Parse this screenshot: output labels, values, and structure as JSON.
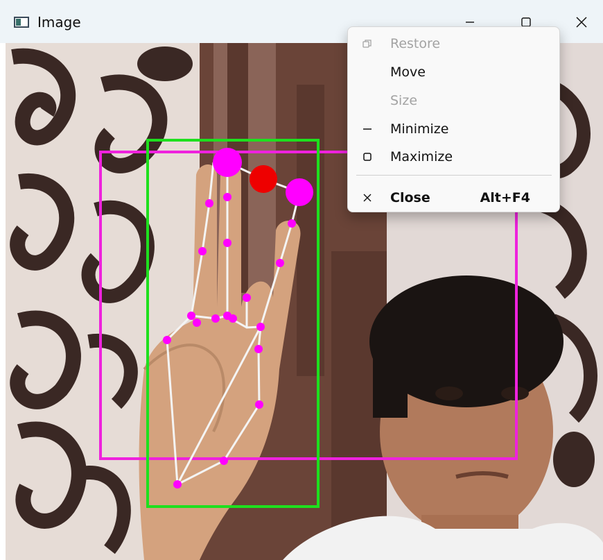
{
  "window": {
    "title": "Image",
    "icon": "app-window-icon",
    "controls": {
      "minimize": "minimize-icon",
      "maximize": "maximize-icon",
      "close": "close-icon"
    }
  },
  "menu": {
    "items": [
      {
        "label": "Restore",
        "icon": "restore-icon",
        "enabled": false,
        "shortcut": ""
      },
      {
        "label": "Move",
        "icon": "",
        "enabled": true,
        "shortcut": ""
      },
      {
        "label": "Size",
        "icon": "",
        "enabled": false,
        "shortcut": ""
      },
      {
        "label": "Minimize",
        "icon": "minimize-icon",
        "enabled": true,
        "shortcut": ""
      },
      {
        "label": "Maximize",
        "icon": "maximize-icon",
        "enabled": true,
        "shortcut": ""
      },
      {
        "label": "Close",
        "icon": "close-icon",
        "enabled": true,
        "shortcut": "Alt+F4",
        "bold": true
      }
    ]
  },
  "overlay_colors": {
    "outer_box": "#ee22dd",
    "hand_box": "#1ee01e",
    "landmark": "#ff00ff",
    "selected_landmark": "#ee0000",
    "skeleton": "#f4f4f4"
  }
}
